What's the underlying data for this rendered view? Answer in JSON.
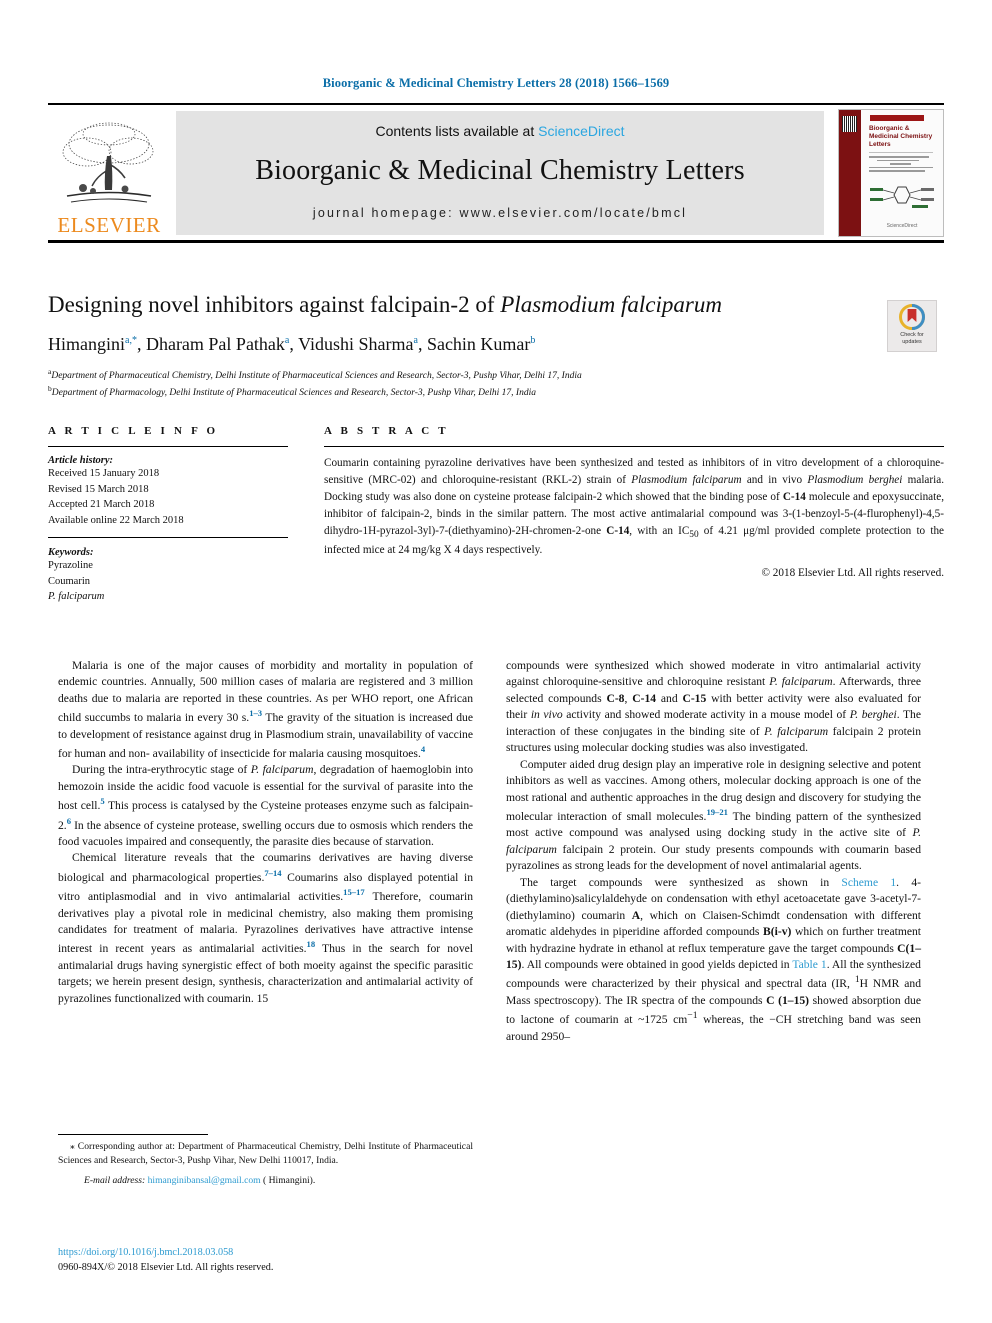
{
  "running_head": "Bioorganic & Medicinal Chemistry Letters 28 (2018) 1566–1569",
  "masthead": {
    "contents_prefix": "Contents lists available at ",
    "sciencedirect": "ScienceDirect",
    "journal_title": "Bioorganic & Medicinal Chemistry Letters",
    "journal_homepage": "journal homepage: www.elsevier.com/locate/bmcl",
    "publisher_wordmark": "ELSEVIER",
    "cover": {
      "title": "Bioorganic & Medicinal Chemistry Letters",
      "footer": "ScienceDirect"
    }
  },
  "article": {
    "title_plain": "Designing novel inhibitors against falcipain-2 of ",
    "title_italic": "Plasmodium falciparum",
    "authors_html": "Himangini, Dharam Pal Pathak, Vidushi Sharma, Sachin Kumar",
    "authors": [
      {
        "name": "Himangini",
        "sup": "a,*"
      },
      {
        "name": "Dharam Pal Pathak",
        "sup": "a"
      },
      {
        "name": "Vidushi Sharma",
        "sup": "a"
      },
      {
        "name": "Sachin Kumar",
        "sup": "b"
      }
    ],
    "affiliations": [
      {
        "marker": "a",
        "text": "Department of Pharmaceutical Chemistry, Delhi Institute of Pharmaceutical Sciences and Research, Sector-3, Pushp Vihar, Delhi 17, India"
      },
      {
        "marker": "b",
        "text": "Department of Pharmacology, Delhi Institute of Pharmaceutical Sciences and Research, Sector-3, Pushp Vihar, Delhi 17, India"
      }
    ],
    "crossmark_label": "Check for\nupdates"
  },
  "article_info": {
    "heading": "A R T I C L E   I N F O",
    "history_label": "Article history:",
    "history": [
      "Received 15 January 2018",
      "Revised 15 March 2018",
      "Accepted 21 March 2018",
      "Available online 22 March 2018"
    ],
    "keywords_label": "Keywords:",
    "keywords": [
      "Pyrazoline",
      "Coumarin",
      "P. falciparum"
    ]
  },
  "abstract": {
    "heading": "A B S T R A C T",
    "copyright": "© 2018 Elsevier Ltd. All rights reserved."
  },
  "body": {
    "left_paragraphs": [
      "Malaria is one of the major causes of morbidity and mortality in population of endemic countries. Annually, 500 million cases of malaria are registered and 3 million deaths due to malaria are reported in these countries. As per WHO report, one African child succumbs to malaria in every 30 s.",
      "During the intra-erythrocytic stage of P. falciparum, degradation of haemoglobin into hemozoin inside the acidic food vacuole is essential for the survival of parasite into the host cell.",
      "Chemical literature reveals that the coumarins derivatives are having diverse biological and pharmacological properties."
    ],
    "right_paragraphs": [
      "compounds were synthesized which showed moderate in vitro antimalarial activity against chloroquine-sensitive and chloroquine resistant P. falciparum.",
      "Computer aided drug design play an imperative role in designing selective and potent inhibitors as well as vaccines.",
      "The target compounds were synthesized as shown in Scheme 1."
    ],
    "refs": [
      "1–3",
      "4",
      "5",
      "6",
      "7–14",
      "15–17",
      "18",
      "19–21"
    ],
    "links": [
      "Scheme 1",
      "Table 1"
    ]
  },
  "footnote": {
    "corresponding": "⁎ Corresponding author at: Department of Pharmaceutical Chemistry, Delhi Institute of Pharmaceutical Sciences and Research, Sector-3, Pushp Vihar, New Delhi 110017, India.",
    "email_label": "E-mail address:",
    "email": "himanginibansal@gmail.com",
    "email_owner": "( Himangini)."
  },
  "doi_block": {
    "doi": "https://doi.org/10.1016/j.bmcl.2018.03.058",
    "issn_copyright": "0960-894X/© 2018 Elsevier Ltd. All rights reserved."
  },
  "colors": {
    "link_blue": "#2e9bd0",
    "head_blue": "#0b6ea8",
    "elsevier_orange": "#ec8a1e",
    "cover_red": "#7c1112",
    "masthead_grey": "#e3e3e3"
  }
}
